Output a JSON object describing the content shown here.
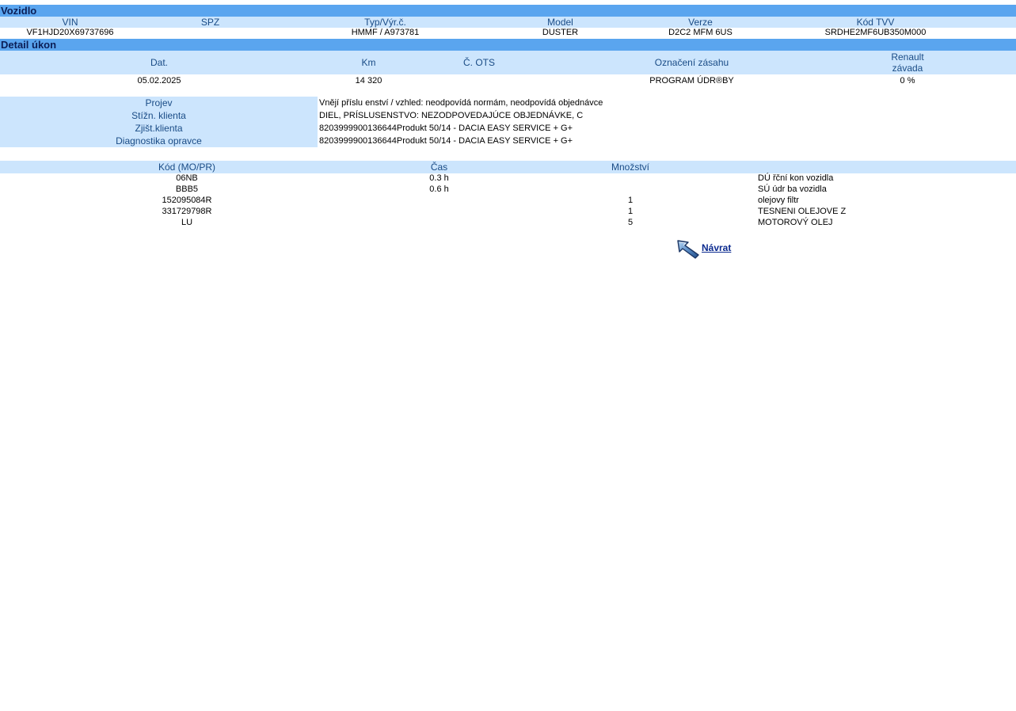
{
  "vehicle": {
    "title": "Vozidlo",
    "headers": {
      "vin": "VIN",
      "spz": "SPZ",
      "typ": "Typ/Výr.č.",
      "model": "Model",
      "verze": "Verze",
      "kod_tvv": "Kód TVV"
    },
    "values": {
      "vin": "VF1HJD20X69737696",
      "spz": "",
      "typ": "HMMF / A973781",
      "model": "DUSTER",
      "verze": "D2C2 MFM 6US",
      "kod_tvv": "SRDHE2MF6UB350M000"
    }
  },
  "detail": {
    "title": "Detail úkon",
    "headers": {
      "dat": "Dat.",
      "km": "Km",
      "ots": "Č. OTS",
      "oznaceni": "Označení zásahu",
      "renault_line1": "Renault",
      "renault_line2": "závada"
    },
    "values": {
      "dat": "05.02.2025",
      "km": "14 320",
      "ots": "",
      "oznaceni": "PROGRAM ÚDR®BY",
      "renault": "0 %"
    }
  },
  "issue": {
    "rows": [
      {
        "label": "Projev",
        "value": "Vnějí příslu enství / vzhled: neodpovídá normám, neodpovídá objednávce"
      },
      {
        "label": "Stížn. klienta",
        "value": "DIEL, PRÍSLUSENSTVO: NEZODPOVEDAJÚCE OBJEDNÁVKE, C"
      },
      {
        "label": "Zjišt.klienta",
        "value": "8203999900136644Produkt 50/14 - DACIA EASY SERVICE + G+"
      },
      {
        "label": "Diagnostika opravce",
        "value": "8203999900136644Produkt 50/14 - DACIA EASY SERVICE + G+"
      }
    ]
  },
  "parts": {
    "headers": {
      "kod": "Kód (MO/PR)",
      "cas": "Čas",
      "mnozstvi": "Množství"
    },
    "rows": [
      {
        "kod": "06NB",
        "cas": "0.3 h",
        "mnozstvi": "",
        "popis": "DÚ řční kon vozidla"
      },
      {
        "kod": "BBB5",
        "cas": "0.6 h",
        "mnozstvi": "",
        "popis": "SÚ údr ba vozidla"
      },
      {
        "kod": "152095084R",
        "cas": "",
        "mnozstvi": "1",
        "popis": "olejovy filtr"
      },
      {
        "kod": "331729798R",
        "cas": "",
        "mnozstvi": "1",
        "popis": "TESNENI OLEJOVE Z"
      },
      {
        "kod": "LU",
        "cas": "",
        "mnozstvi": "5",
        "popis": "MOTOROVÝ OLEJ"
      }
    ]
  },
  "nav": {
    "return_label": "Návrat",
    "return_icon": "back-arrow-icon"
  },
  "colors": {
    "section_bar": "#5aa5ef",
    "header_bg": "#cce5fd",
    "header_text": "#1a4c86",
    "link": "#0b2a8f"
  }
}
